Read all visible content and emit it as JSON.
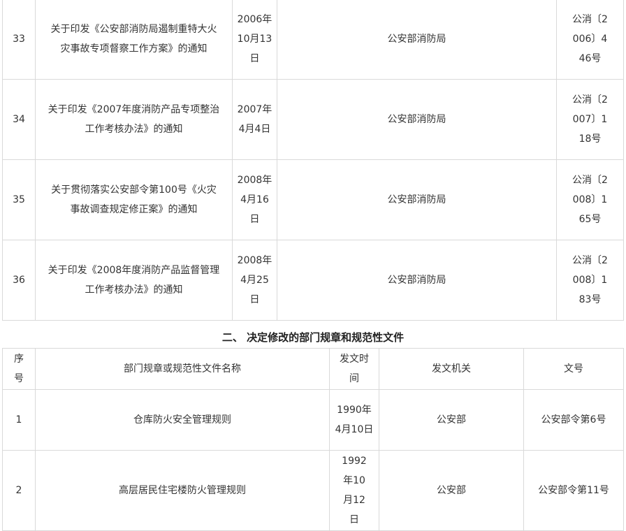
{
  "table1": {
    "rows": [
      {
        "no": "33",
        "title": "关于印发《公安部消防局遏制重特大火灾事故专项督察工作方案》的通知",
        "date": "2006年10月13日",
        "issuer": "公安部消防局",
        "docno": "公消〔2006〕446号"
      },
      {
        "no": "34",
        "title": "关于印发《2007年度消防产品专项整治工作考核办法》的通知",
        "date": "2007年4月4日",
        "issuer": "公安部消防局",
        "docno": "公消〔2007〕118号"
      },
      {
        "no": "35",
        "title": "关于贯彻落实公安部令第100号《火灾事故调查规定修正案》的通知",
        "date": "2008年4月16日",
        "issuer": "公安部消防局",
        "docno": "公消〔2008〕165号"
      },
      {
        "no": "36",
        "title": "关于印发《2008年度消防产品监督管理工作考核办法》的通知",
        "date": "2008年4月25日",
        "issuer": "公安部消防局",
        "docno": "公消〔2008〕183号"
      }
    ]
  },
  "section2": {
    "heading": "二、 决定修改的部门规章和规范性文件",
    "headers": {
      "no": "序号",
      "name": "部门规章或规范性文件名称",
      "date": "发文时间",
      "issuer": "发文机关",
      "docno": "文号"
    },
    "rows": [
      {
        "no": "1",
        "name": "仓库防火安全管理规则",
        "date": "1990年4月10日",
        "issuer": "公安部",
        "docno": "公安部令第6号"
      },
      {
        "no": "2",
        "name": "高层居民住宅楼防火管理规则",
        "date": "1992年10月12日",
        "issuer": "公安部",
        "docno": "公安部令第11号"
      }
    ]
  }
}
